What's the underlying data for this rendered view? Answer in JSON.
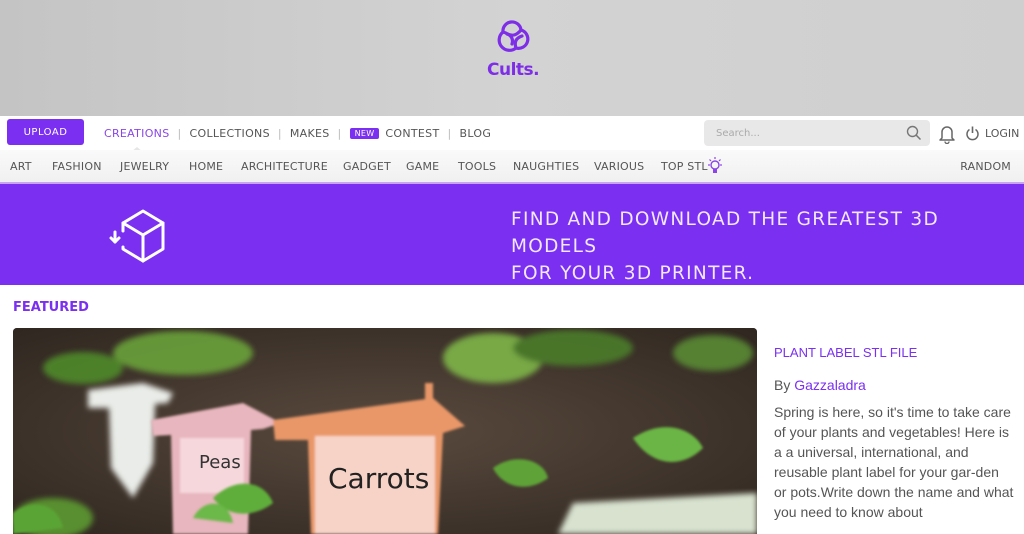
{
  "brand": {
    "name": "Cults.",
    "color": "#7b2ff0"
  },
  "navbar": {
    "upload_label": "UPLOAD",
    "links": [
      {
        "label": "CREATIONS",
        "active": true
      },
      {
        "label": "COLLECTIONS"
      },
      {
        "label": "MAKES"
      },
      {
        "label": "CONTEST",
        "badge": "NEW"
      },
      {
        "label": "BLOG"
      }
    ],
    "search_placeholder": "Search...",
    "login_label": "LOGIN"
  },
  "categories": [
    "ART",
    "FASHION",
    "JEWELRY",
    "HOME",
    "ARCHITECTURE",
    "GADGET",
    "GAME",
    "TOOLS",
    "NAUGHTIES",
    "VARIOUS",
    "TOP STL"
  ],
  "random_label": "RANDOM",
  "banner": {
    "line1": "FIND AND DOWNLOAD THE GREATEST 3D MODELS",
    "line2": "FOR YOUR 3D PRINTER."
  },
  "featured": {
    "section_label": "FEATURED",
    "image_labels": [
      "Peas",
      "Carrots"
    ],
    "title": "PLANT LABEL STL FILE",
    "by_prefix": "By",
    "author": "Gazzaladra",
    "description": "Spring is here, so it's time to take care of your plants and vegetables! Here is a a universal, international, and reusable plant label for your gar-den or pots.Write down the name and what you need to know about"
  }
}
